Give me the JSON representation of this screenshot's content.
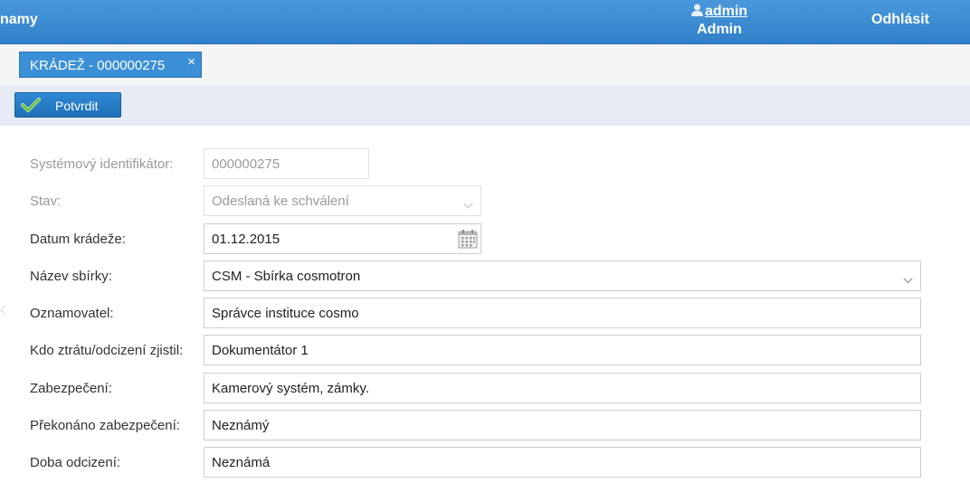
{
  "header": {
    "brand": "namy",
    "user_name": "admin",
    "user_role": "Admin",
    "logout_label": "Odhlásit"
  },
  "tab": {
    "label": "KRÁDEŽ - 000000275",
    "close_glyph": "×"
  },
  "toolbar": {
    "confirm_label": "Potvrdit"
  },
  "form": {
    "system_id": {
      "label": "Systémový identifikátor:",
      "value": "000000275"
    },
    "status": {
      "label": "Stav:",
      "value": "Odeslaná ke schválení"
    },
    "theft_date": {
      "label": "Datum krádeže:",
      "value": "01.12.2015"
    },
    "collection_name": {
      "label": "Název sbírky:",
      "value": "CSM - Sbírka cosmotron"
    },
    "reporter": {
      "label": "Oznamovatel:",
      "value": "Správce instituce cosmo"
    },
    "discovered_by": {
      "label": "Kdo ztrátu/odcizení zjistil:",
      "value": "Dokumentátor 1"
    },
    "security": {
      "label": "Zabezpečení:",
      "value": "Kamerový systém, zámky."
    },
    "security_overcome": {
      "label": "Překonáno zabezpečení:",
      "value": "Neznámý"
    },
    "theft_time": {
      "label": "Doba odcizení:",
      "value": "Neznámá"
    }
  },
  "colors": {
    "header_bg": "#3a8ad2",
    "tab_bg": "#3b8fd6",
    "toolbar_bg": "#e6ebf5",
    "button_bg": "#2a80cc"
  },
  "icons": [
    "user-icon",
    "close-icon",
    "checkmark-icon",
    "chevron-down-icon",
    "calendar-icon",
    "chevron-left-icon"
  ]
}
